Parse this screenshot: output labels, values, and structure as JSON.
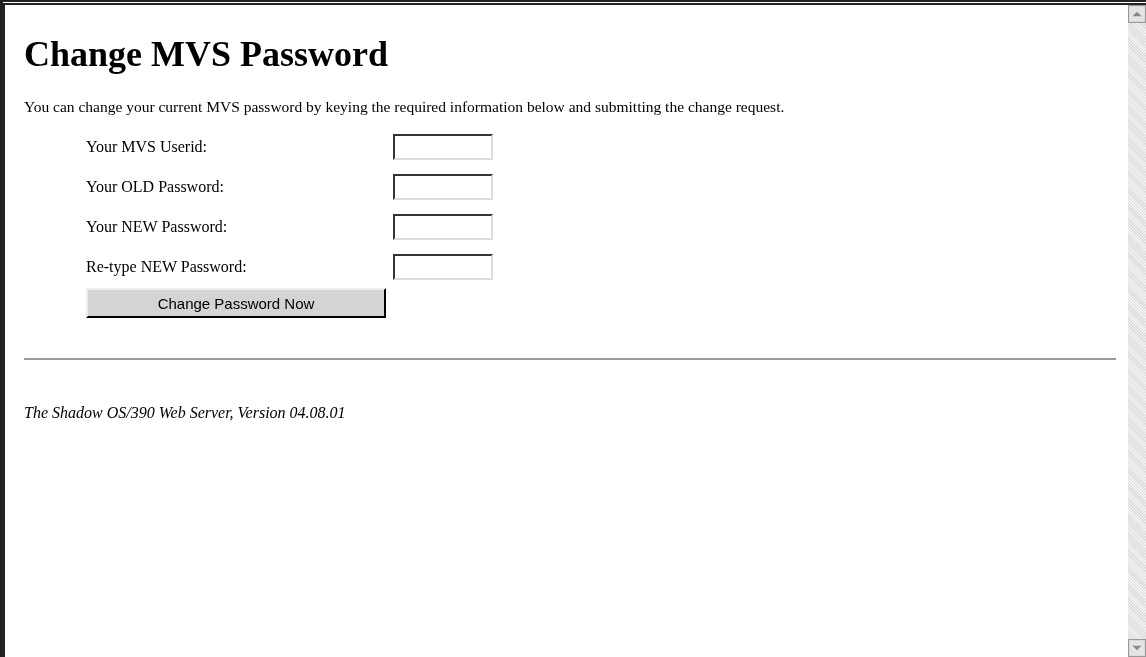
{
  "heading": "Change MVS Password",
  "intro": "You can change your current MVS password by keying the required information below and submitting the change request.",
  "fields": [
    {
      "label": "Your MVS Userid:"
    },
    {
      "label": "Your OLD Password:"
    },
    {
      "label": "Your NEW Password:"
    },
    {
      "label": "Re-type NEW Password:"
    }
  ],
  "submit_button": "Change Password Now",
  "footer": "The Shadow OS/390 Web Server, Version 04.08.01"
}
